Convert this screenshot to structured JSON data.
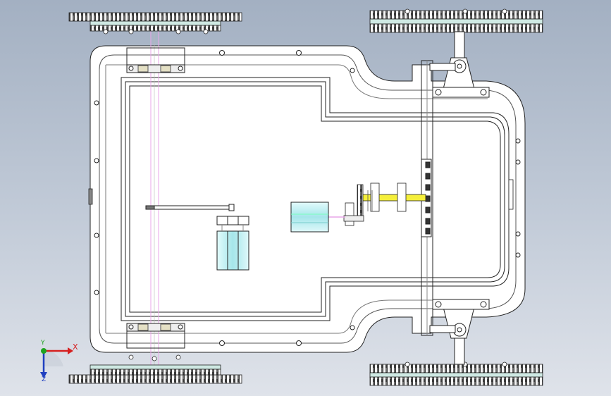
{
  "view": {
    "background_top": "#a3b0c2",
    "background_bottom": "#dfe3ea",
    "body_fill": "#ffffff",
    "line_color": "#222222",
    "accent_cyan": "#bfeff2",
    "accent_yellow": "#f5ef3a",
    "accent_pink": "#e8a6e8"
  },
  "triad": {
    "x_label": "X",
    "y_label": "Y",
    "z_label": "Z",
    "x_color": "#d62020",
    "y_color": "#1fa31f",
    "z_color": "#2040c0"
  },
  "parts": [
    "chassis-frame",
    "inner-tray",
    "rear-axle-shaft",
    "front-steering-assembly",
    "gear-train",
    "motor-block",
    "battery-pack",
    "track-sprockets"
  ]
}
